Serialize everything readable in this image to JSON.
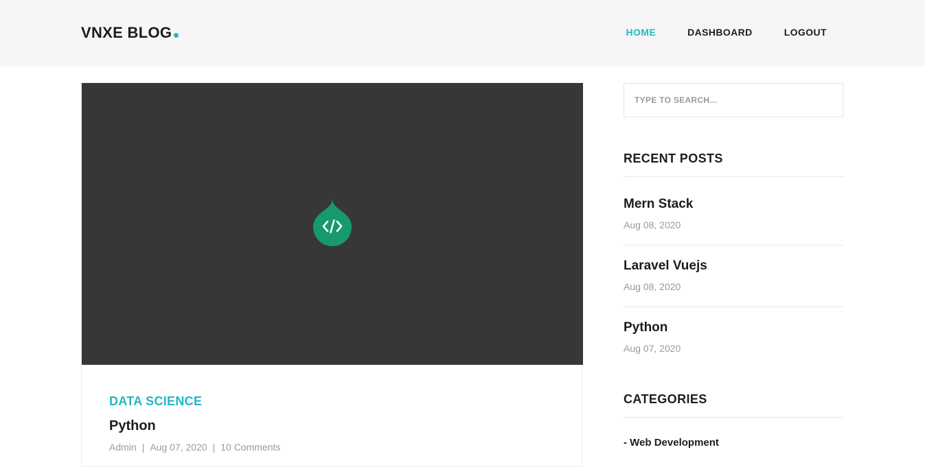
{
  "header": {
    "logo": "VNXE BLOG",
    "nav": [
      {
        "label": "HOME",
        "active": true
      },
      {
        "label": "DASHBOARD",
        "active": false
      },
      {
        "label": "LOGOUT",
        "active": false
      }
    ]
  },
  "post": {
    "category": "DATA SCIENCE",
    "title": "Python",
    "author": "Admin",
    "date": "Aug 07, 2020",
    "comments": "10 Comments",
    "image_icon": "code-drop-icon"
  },
  "sidebar": {
    "search": {
      "placeholder": "TYPE TO SEARCH..."
    },
    "recent_posts": {
      "title": "RECENT POSTS",
      "items": [
        {
          "title": "Mern Stack",
          "date": "Aug 08, 2020"
        },
        {
          "title": "Laravel Vuejs",
          "date": "Aug 08, 2020"
        },
        {
          "title": "Python",
          "date": "Aug 07, 2020"
        }
      ]
    },
    "categories": {
      "title": "CATEGORIES",
      "items": [
        "- Web Development"
      ]
    }
  },
  "colors": {
    "accent": "#25b7c3",
    "image_bg": "#373737",
    "icon_green": "#16996f",
    "header_bg": "#f6f6f6"
  }
}
